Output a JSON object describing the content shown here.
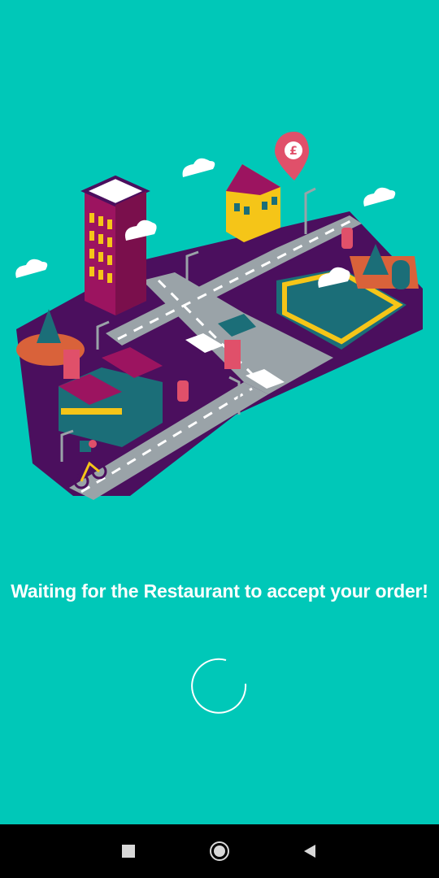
{
  "status": {
    "message": "Waiting for the Restaurant to accept your order!"
  },
  "illustration": {
    "subject": "isometric-city-delivery",
    "pin_symbol": "£"
  },
  "spinner": {
    "state": "loading"
  },
  "navbar": {
    "recent_icon": "square-icon",
    "home_icon": "circle-icon",
    "back_icon": "triangle-back-icon"
  },
  "colors": {
    "background": "#00C8B8",
    "street_purple": "#4B0F5E",
    "accent_pink": "#E0506A",
    "building_magenta": "#9C1460",
    "navbar": "#000000",
    "text": "#FFFFFF"
  }
}
